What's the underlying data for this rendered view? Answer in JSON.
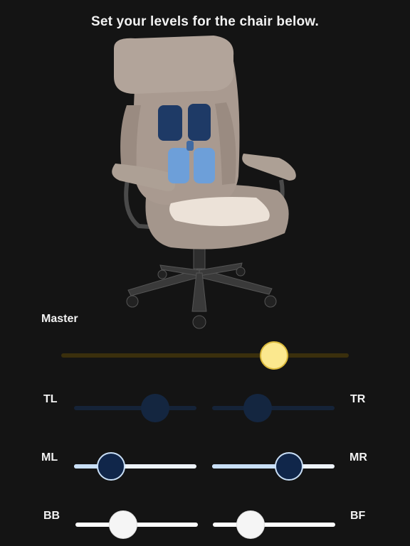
{
  "title": "Set your levels for the chair below.",
  "colors": {
    "background": "#141414",
    "master_track": "#3a2f0c",
    "master_thumb": "#fbe88e",
    "top_track": "#152338",
    "top_thumb": "#142640",
    "mid_fill": "#c9dff7",
    "mid_track": "#eef3fa",
    "mid_thumb": "#10264a",
    "bottom_track": "#ffffff",
    "bottom_thumb": "#f5f5f5"
  },
  "chair": {
    "upper_pads_color": "#1e3a66",
    "lower_pads_color": "#6d9fd9",
    "seat_pad_color": "#ece2d8"
  },
  "sliders": {
    "master": {
      "label": "Master",
      "value": 0.74
    },
    "tl": {
      "label": "TL",
      "value": 0.66
    },
    "tr": {
      "label": "TR",
      "value": 0.37
    },
    "ml": {
      "label": "ML",
      "value": 0.3
    },
    "mr": {
      "label": "MR",
      "value": 0.63
    },
    "bb": {
      "label": "BB",
      "value": 0.39
    },
    "bf": {
      "label": "BF",
      "value": 0.31
    }
  }
}
